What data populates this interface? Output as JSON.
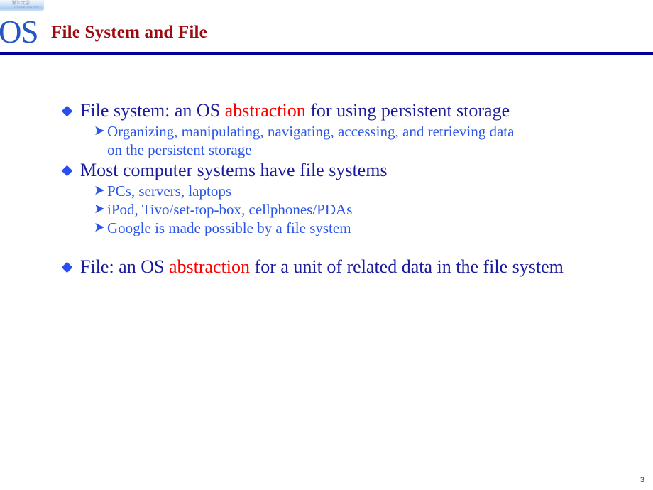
{
  "logo": {
    "mark_text": "浙江大学",
    "sub_text": "ZHEJIANG UNIVERSITY"
  },
  "header": {
    "os_label": "OS",
    "title": "File System and File"
  },
  "colors": {
    "title_red": "#9c0a10",
    "rule_navy": "#000099",
    "level1_blue": "#1b1b9e",
    "level2_blue": "#2a55e8",
    "highlight_red": "#fe0000",
    "bullet_blue": "#2b4ef0",
    "os_blue": "#2457c5"
  },
  "icons": {
    "diamond_bullet": "diamond-bullet-icon",
    "arrow_bullet": "➤"
  },
  "content": {
    "block1": {
      "lead_a": "File system: an OS ",
      "highlight": "abstraction",
      "lead_b": " for using persistent storage",
      "sub": [
        {
          "line1": "Organizing, manipulating, navigating, accessing, and retrieving data",
          "line2": "on the persistent storage"
        }
      ]
    },
    "block2": {
      "lead": "Most computer systems have file systems",
      "sub": [
        {
          "line1": "PCs, servers, laptops"
        },
        {
          "line1": "iPod, Tivo/set-top-box, cellphones/PDAs"
        },
        {
          "line1": "Google is made possible by a file system"
        }
      ]
    },
    "block3": {
      "lead_a": "File: an OS ",
      "highlight": "abstraction",
      "lead_b": " for a unit of related data in the file system"
    }
  },
  "footer": {
    "page_number": "3"
  }
}
